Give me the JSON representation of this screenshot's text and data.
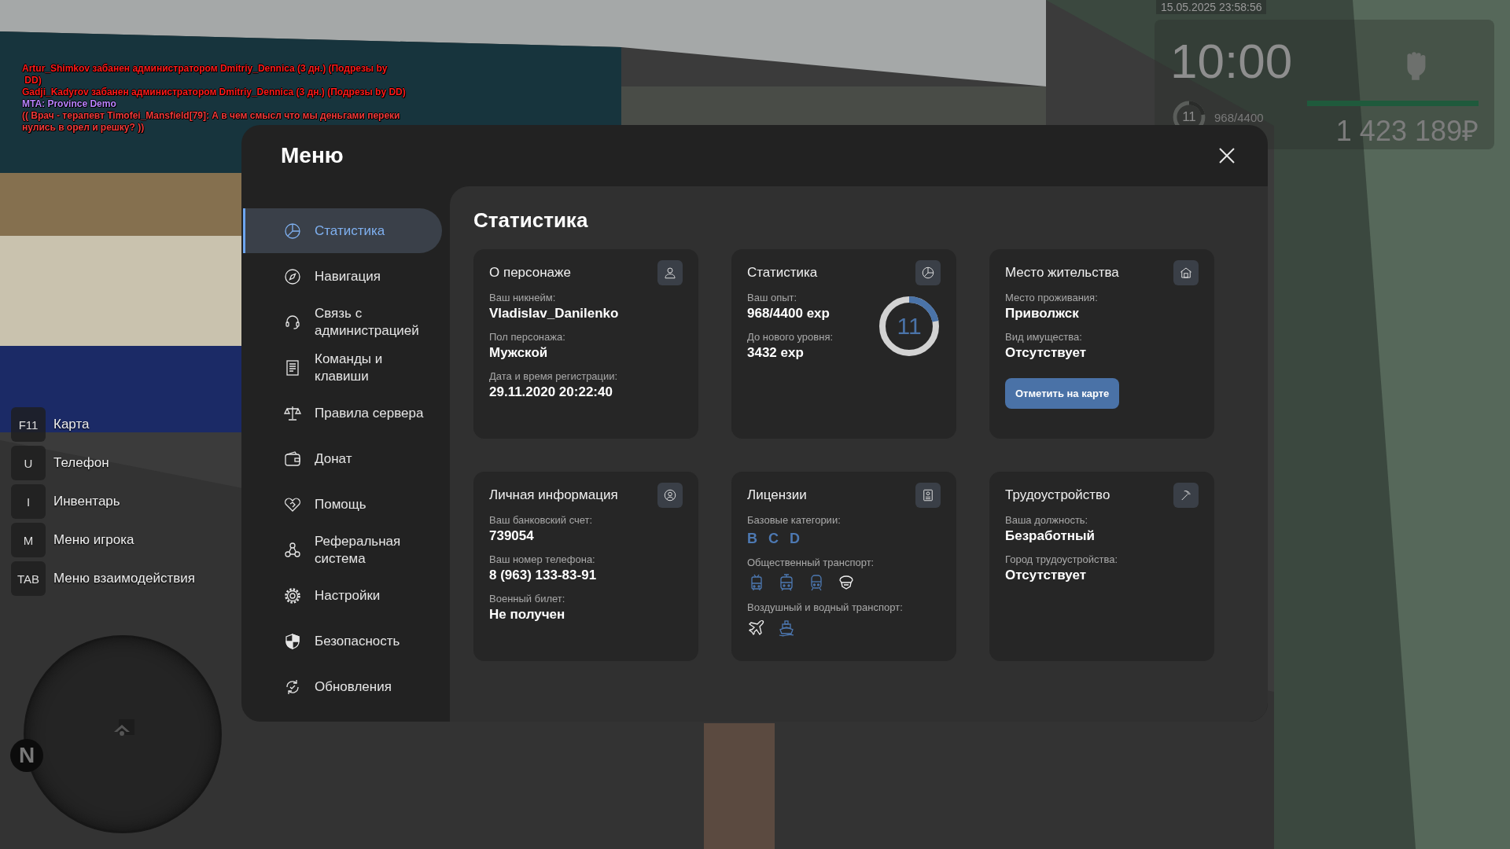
{
  "chat": [
    {
      "text": "Artur_Shimkov забанен администратором Dmitriy_Dennica (3 дн.) (Подрезы by",
      "color": "#ff1a1a"
    },
    {
      "text": " DD)",
      "color": "#ff1a1a"
    },
    {
      "text": "Gadji_Kadyrov забанен администратором Dmitriy_Dennica (3 дн.) (Подрезы by DD)",
      "color": "#ff1a1a"
    },
    {
      "text": "MTA: Province Demo",
      "color": "#b884ff"
    },
    {
      "text": "(( Врач - терапевт Timofei_Mansfield[79]: А в чем смысл что мы деньгами переки",
      "color": "#f03a3a"
    },
    {
      "text": "нулись в орел и решку? ))",
      "color": "#f03a3a"
    }
  ],
  "hud": {
    "datetime": "15.05.2025 23:58:56",
    "clock": "10:00",
    "xp": {
      "number": "11",
      "text": "968/4400",
      "level": 0.22
    },
    "bar": {
      "level": 1
    },
    "money": "1 423 189₽"
  },
  "keybinds": [
    {
      "key": "F11",
      "label": "Карта"
    },
    {
      "key": "U",
      "label": "Телефон"
    },
    {
      "key": "I",
      "label": "Инвентарь"
    },
    {
      "key": "M",
      "label": "Меню игрока"
    },
    {
      "key": "TAB",
      "label": "Меню взаимодействия"
    }
  ],
  "minimap": {
    "north": "N"
  },
  "menu": {
    "title": "Меню",
    "items": [
      {
        "label": "Статистика",
        "selected": true
      },
      {
        "label": "Навигация",
        "selected": false
      },
      {
        "label": "Связь с администрацией",
        "selected": false
      },
      {
        "label": "Команды и клавиши",
        "selected": false
      },
      {
        "label": "Правила сервера",
        "selected": false
      },
      {
        "label": "Донат",
        "selected": false
      },
      {
        "label": "Помощь",
        "selected": false
      },
      {
        "label": "Реферальная система",
        "selected": false
      },
      {
        "label": "Настройки",
        "selected": false
      },
      {
        "label": "Безопасность",
        "selected": false
      },
      {
        "label": "Обновления",
        "selected": false
      }
    ],
    "heading": "Статистика",
    "cards": [
      {
        "kind": "fields",
        "title": "О персонаже",
        "fields": [
          {
            "label": "Ваш никнейм:",
            "value": "Vladislav_Danilenko"
          },
          {
            "label": "Пол персонажа:",
            "value": "Мужской"
          },
          {
            "label": "Дата и время регистрации:",
            "value": "29.11.2020 20:22:40"
          }
        ]
      },
      {
        "kind": "progress",
        "title": "Статистика",
        "fields": [
          {
            "label": "Ваш опыт:",
            "value": "968/4400 exp"
          },
          {
            "label": "До нового уровня:",
            "value": "3432 exp"
          }
        ],
        "ring": {
          "number": "11",
          "level": 0.22
        }
      },
      {
        "kind": "fields",
        "title": "Место жительства",
        "fields": [
          {
            "label": "Место проживания:",
            "value": "Приволжск"
          },
          {
            "label": "Вид имущества:",
            "value": "Отсутствует"
          }
        ],
        "button": "Отметить на карте"
      },
      {
        "kind": "fields",
        "title": "Личная информация",
        "fields": [
          {
            "label": "Ваш банковский счет:",
            "value": "739054"
          },
          {
            "label": "Ваш номер телефона:",
            "value": "8 (963) 133-83-91"
          },
          {
            "label": "Военный билет:",
            "value": "Не получен"
          }
        ]
      },
      {
        "kind": "licenses",
        "title": "Лицензии",
        "sections": [
          {
            "kind": "letters",
            "label": "Базовые категории:",
            "items": [
              {
                "text": "B",
                "owned": true
              },
              {
                "text": "C",
                "owned": true
              },
              {
                "text": "D",
                "owned": true
              }
            ]
          },
          {
            "kind": "icons",
            "label": "Общественный транспорт:",
            "items": [
              {
                "owned": true
              },
              {
                "owned": true
              },
              {
                "owned": true
              },
              {
                "owned": false
              }
            ]
          },
          {
            "kind": "icons",
            "label": "Воздушный и водный транспорт:",
            "items": [
              {
                "owned": false
              },
              {
                "owned": true
              }
            ]
          }
        ]
      },
      {
        "kind": "fields",
        "title": "Трудоустройство",
        "fields": [
          {
            "label": "Ваша должность:",
            "value": "Безработный"
          },
          {
            "label": "Город трудоустройства:",
            "value": "Отсутствует"
          }
        ]
      }
    ]
  }
}
